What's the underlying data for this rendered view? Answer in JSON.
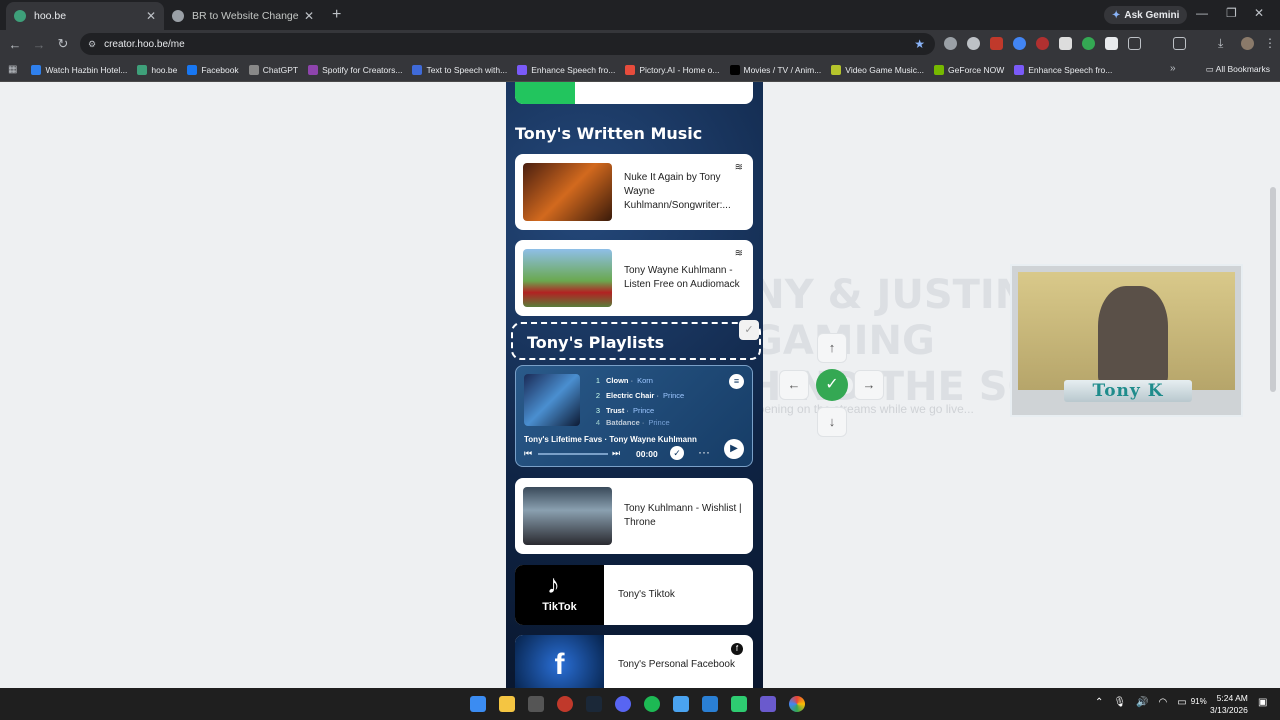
{
  "tabs": [
    {
      "title": "hoo.be",
      "favicon_color": "#3ea07a"
    },
    {
      "title": "BR to Website Change",
      "favicon_color": "#9aa0a6"
    }
  ],
  "ask_gemini": "Ask Gemini",
  "url": "creator.hoo.be/me",
  "bookmarks": [
    {
      "label": "Watch Hazbin Hotel...",
      "color": "#2f80ed"
    },
    {
      "label": "hoo.be",
      "color": "#3ea07a"
    },
    {
      "label": "Facebook",
      "color": "#1877f2"
    },
    {
      "label": "ChatGPT",
      "color": "#888"
    },
    {
      "label": "Spotify for Creators...",
      "color": "#8e44ad"
    },
    {
      "label": "Text to Speech with...",
      "color": "#3f6ad8"
    },
    {
      "label": "Enhance Speech fro...",
      "color": "#7a5af8"
    },
    {
      "label": "Pictory.AI - Home o...",
      "color": "#e74c3c"
    },
    {
      "label": "Movies / TV / Anim...",
      "color": "#000"
    },
    {
      "label": "Video Game Music...",
      "color": "#b5c42c"
    },
    {
      "label": "GeForce NOW",
      "color": "#76b900"
    },
    {
      "label": "Enhance Speech fro...",
      "color": "#7a5af8"
    }
  ],
  "all_bookmarks": "All Bookmarks",
  "background": {
    "title_lines": [
      "TONY & JUSTIN",
      "GAMING",
      "BEHIND THE SCENES"
    ],
    "subtitle": "What's happening on the streams while we go live..."
  },
  "written_music": {
    "heading": "Tony's Written Music",
    "items": [
      {
        "label": "Nuke It Again by Tony Wayne Kuhlmann/Songwriter:..."
      },
      {
        "label": "Tony Wayne Kuhlmann - Listen Free on Audiomack"
      }
    ]
  },
  "playlists": {
    "heading": "Tony's Playlists",
    "tracks": [
      {
        "n": "1",
        "title": "Clown",
        "artist": "Korn"
      },
      {
        "n": "2",
        "title": "Electric Chair",
        "artist": "Prince"
      },
      {
        "n": "3",
        "title": "Trust",
        "artist": "Prince"
      },
      {
        "n": "4",
        "title": "Batdance",
        "artist": "Prince"
      }
    ],
    "playlist_title": "Tony's Lifetime Favs · Tony Wayne Kuhlmann",
    "time": "00:00"
  },
  "links": [
    {
      "label": "Tony Kuhlmann - Wishlist | Throne"
    },
    {
      "label": "Tony's Tiktok",
      "thumb_text": "TikTok"
    },
    {
      "label": "Tony's Personal Facebook"
    }
  ],
  "webcam_name": "Tony K",
  "tray": {
    "battery": "91%",
    "time": "5:24 AM",
    "date": "3/13/2026"
  },
  "accent": "#34a853"
}
